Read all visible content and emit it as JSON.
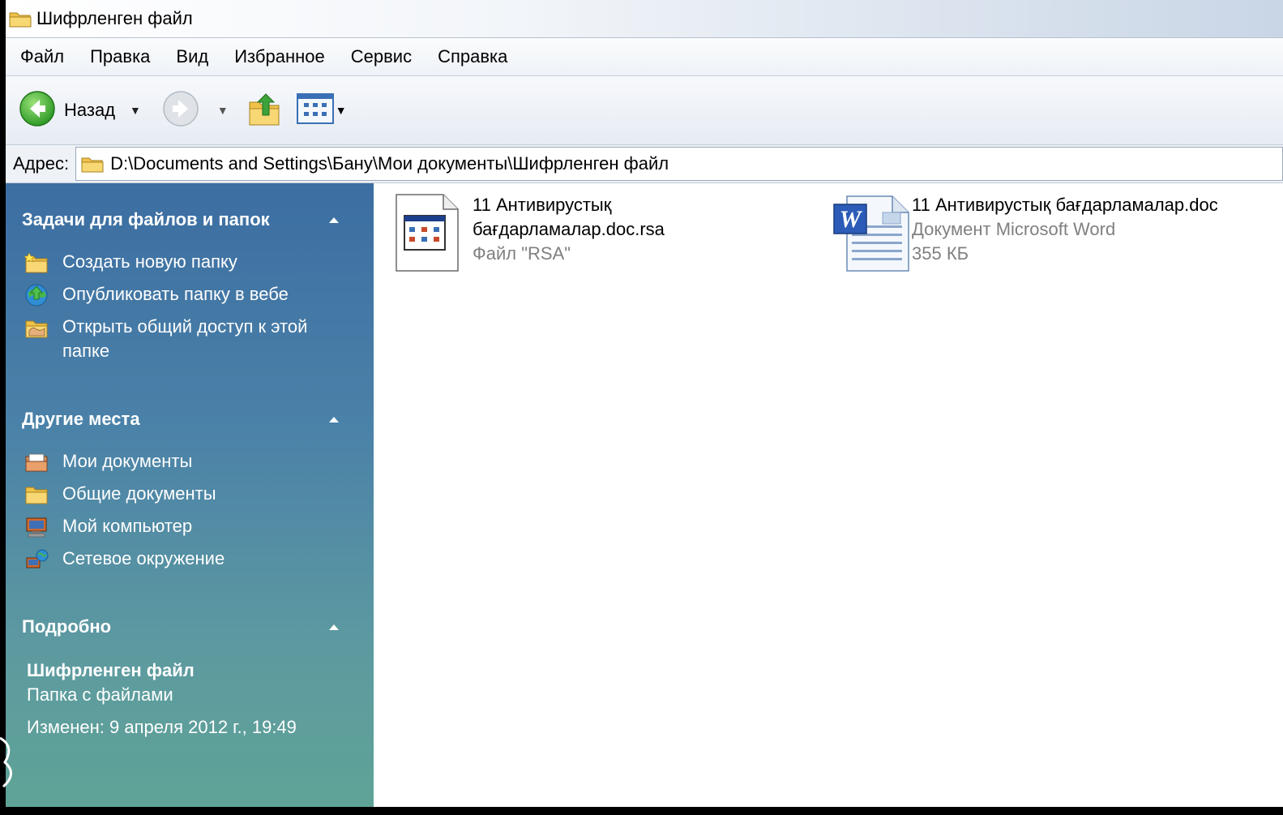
{
  "window": {
    "title": "Шифрленген файл"
  },
  "menu": {
    "items": [
      "Файл",
      "Правка",
      "Вид",
      "Избранное",
      "Сервис",
      "Справка"
    ]
  },
  "toolbar": {
    "back_label": "Назад"
  },
  "address": {
    "label": "Адрес:",
    "value": "D:\\Documents and Settings\\Бану\\Мои документы\\Шифрленген файл"
  },
  "taskpane": {
    "tasks": {
      "header": "Задачи для файлов и папок",
      "items": [
        {
          "label": "Создать новую папку",
          "icon": "new-folder-icon"
        },
        {
          "label": "Опубликовать папку в вебе",
          "icon": "publish-web-icon"
        },
        {
          "label": "Открыть общий доступ к этой папке",
          "icon": "share-folder-icon"
        }
      ]
    },
    "places": {
      "header": "Другие места",
      "items": [
        {
          "label": "Мои документы",
          "icon": "my-documents-icon"
        },
        {
          "label": "Общие документы",
          "icon": "shared-documents-icon"
        },
        {
          "label": "Мой компьютер",
          "icon": "my-computer-icon"
        },
        {
          "label": "Сетевое окружение",
          "icon": "network-places-icon"
        }
      ]
    },
    "details": {
      "header": "Подробно",
      "name": "Шифрленген файл",
      "type": "Папка с файлами",
      "modified": "Изменен: 9 апреля 2012 г., 19:49"
    }
  },
  "files": [
    {
      "name_line1": "11  Антивирустық",
      "name_line2": "бағдарламалар.doc.rsa",
      "type": "Файл \"RSA\"",
      "size": "",
      "icon": "generic-file-icon"
    },
    {
      "name_line1": "11  Антивирустық бағдарламалар.doc",
      "name_line2": "",
      "type": "Документ Microsoft Word",
      "size": "355 КБ",
      "icon": "word-document-icon"
    }
  ],
  "colors": {
    "taskpane_top": "#3c6ea2",
    "taskpane_bottom": "#5fa396",
    "secondary_text": "#808080"
  }
}
